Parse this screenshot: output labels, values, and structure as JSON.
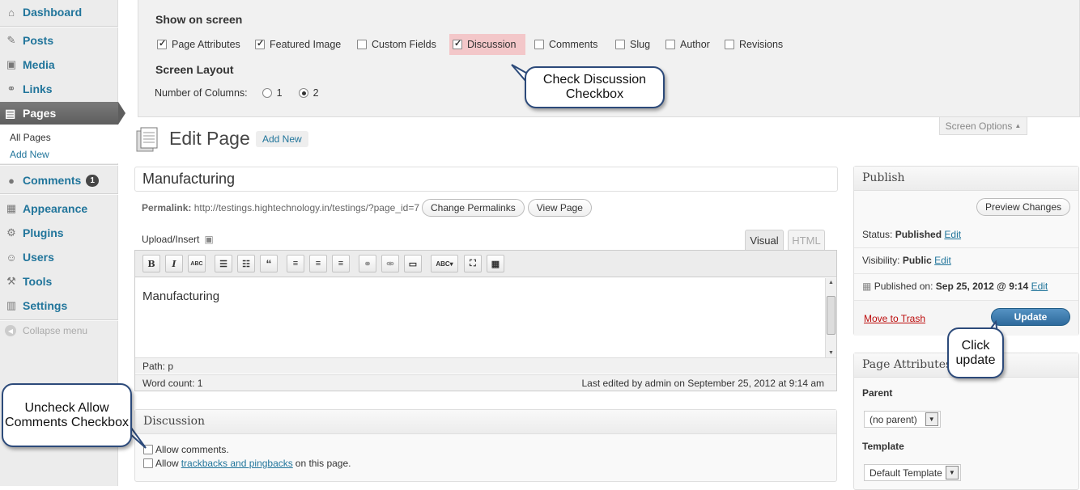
{
  "sidebar": {
    "items": [
      {
        "label": "Dashboard",
        "icon": "dashboard-icon",
        "glyph": "⌂"
      },
      {
        "label": "Posts",
        "icon": "pin-icon",
        "glyph": "✎"
      },
      {
        "label": "Media",
        "icon": "media-icon",
        "glyph": "▣"
      },
      {
        "label": "Links",
        "icon": "link-icon",
        "glyph": "⚭"
      },
      {
        "label": "Pages",
        "icon": "pages-icon",
        "glyph": "▤"
      },
      {
        "label": "Comments",
        "icon": "comment-icon",
        "glyph": "💬",
        "badge": "1"
      },
      {
        "label": "Appearance",
        "icon": "appearance-icon",
        "glyph": "▦"
      },
      {
        "label": "Plugins",
        "icon": "plugin-icon",
        "glyph": "⚙"
      },
      {
        "label": "Users",
        "icon": "users-icon",
        "glyph": "☺"
      },
      {
        "label": "Tools",
        "icon": "tools-icon",
        "glyph": "⚒"
      },
      {
        "label": "Settings",
        "icon": "settings-icon",
        "glyph": "▥"
      }
    ],
    "submenu": [
      "All Pages",
      "Add New"
    ],
    "collapse": "Collapse menu"
  },
  "screen_options": {
    "show_heading": "Show on screen",
    "options": [
      {
        "label": "Page Attributes",
        "checked": true
      },
      {
        "label": "Featured Image",
        "checked": true
      },
      {
        "label": "Custom Fields",
        "checked": false
      },
      {
        "label": "Discussion",
        "checked": true
      },
      {
        "label": "Comments",
        "checked": false
      },
      {
        "label": "Slug",
        "checked": false
      },
      {
        "label": "Author",
        "checked": false
      },
      {
        "label": "Revisions",
        "checked": false
      }
    ],
    "layout_heading": "Screen Layout",
    "columns_label": "Number of Columns:",
    "columns": [
      "1",
      "2"
    ],
    "columns_selected": "2",
    "tab_label": "Screen Options"
  },
  "callouts": {
    "discussion": "Check Discussion Checkbox",
    "update": "Click update",
    "comments": "Uncheck Allow Comments Checkbox"
  },
  "header": {
    "title": "Edit Page",
    "add_new": "Add New"
  },
  "editor": {
    "title_value": "Manufacturing",
    "permalink_label": "Permalink:",
    "permalink_url": "http://testings.hightechnology.in/testings/?page_id=7",
    "change_permalinks": "Change Permalinks",
    "view_page": "View Page",
    "upload_insert": "Upload/Insert",
    "tab_visual": "Visual",
    "tab_html": "HTML",
    "content": "Manufacturing",
    "path": "Path: p",
    "word_count": "Word count: 1",
    "last_edited": "Last edited by admin on September 25, 2012 at 9:14 am"
  },
  "discussion": {
    "title": "Discussion",
    "allow_comments": "Allow comments.",
    "allow_prefix": "Allow",
    "trackbacks_link": "trackbacks and pingbacks",
    "allow_suffix": "on this page."
  },
  "publish": {
    "title": "Publish",
    "preview": "Preview Changes",
    "status_label": "Status:",
    "status_value": "Published",
    "visibility_label": "Visibility:",
    "visibility_value": "Public",
    "published_label": "Published on:",
    "published_value": "Sep 25, 2012 @ 9:14",
    "edit": "Edit",
    "trash": "Move to Trash",
    "update": "Update"
  },
  "page_attributes": {
    "title": "Page Attributes",
    "parent_label": "Parent",
    "parent_value": "(no parent)",
    "template_label": "Template",
    "template_value": "Default Template"
  },
  "colors": {
    "link": "#21759b",
    "highlight": "#f3c7c9",
    "update_button": "#2e7bab"
  }
}
